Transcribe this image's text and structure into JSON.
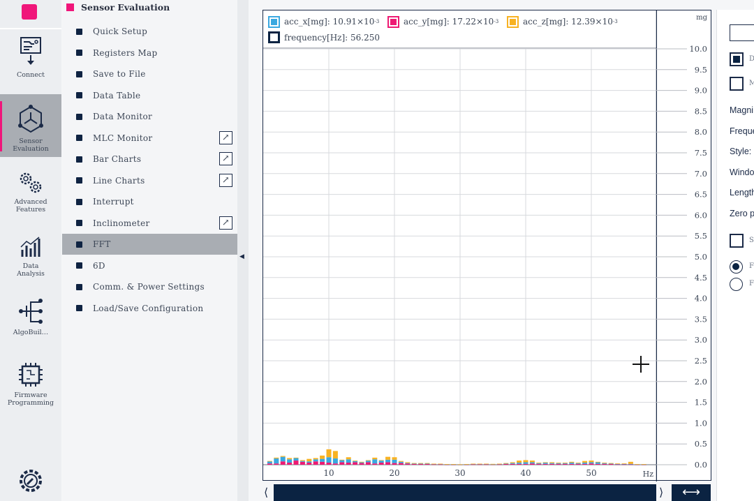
{
  "rail": {
    "items": [
      {
        "label": "Connect",
        "icon": "connect-board-icon"
      },
      {
        "label": "Sensor Evaluation",
        "icon": "sensor-hexagon-icon",
        "selected": true
      },
      {
        "label": "Advanced Features",
        "icon": "gears-icon"
      },
      {
        "label": "Data Analysis",
        "icon": "analysis-chart-icon"
      },
      {
        "label": "AlgoBuil…",
        "icon": "algo-tree-icon"
      },
      {
        "label": "Firmware Programming",
        "icon": "chip-icon"
      }
    ],
    "settings_icon": "settings-gear-icon"
  },
  "menu": {
    "title": "Sensor Evaluation",
    "items": [
      {
        "label": "Quick Setup",
        "external": false
      },
      {
        "label": "Registers Map",
        "external": false
      },
      {
        "label": "Save to File",
        "external": false
      },
      {
        "label": "Data Table",
        "external": false
      },
      {
        "label": "Data Monitor",
        "external": false
      },
      {
        "label": "MLC Monitor",
        "external": true
      },
      {
        "label": "Bar Charts",
        "external": true
      },
      {
        "label": "Line Charts",
        "external": true
      },
      {
        "label": "Interrupt",
        "external": false
      },
      {
        "label": "Inclinometer",
        "external": true
      },
      {
        "label": "FFT",
        "external": false,
        "selected": true
      },
      {
        "label": "6D",
        "external": false
      },
      {
        "label": "Comm. & Power Settings",
        "external": false
      },
      {
        "label": "Load/Save Configuration",
        "external": false
      }
    ]
  },
  "legend": {
    "acc_x": {
      "label": "acc_x[mg]: 10.91×10",
      "exp": "-3",
      "color": "#3aa8e0"
    },
    "acc_y": {
      "label": "acc_y[mg]: 17.22×10",
      "exp": "-3",
      "color": "#ee1a73"
    },
    "acc_z": {
      "label": "acc_z[mg]: 12.39×10",
      "exp": "-3",
      "color": "#f8b222"
    },
    "frequency": {
      "label": "frequency[Hz]: 56.250",
      "color": "#0b2342"
    }
  },
  "chart_data": {
    "type": "bar",
    "stacked": true,
    "xlabel": "Hz",
    "ylabel": "mg",
    "xlim": [
      0,
      60
    ],
    "ylim": [
      0,
      10
    ],
    "xticks": [
      10,
      20,
      30,
      40,
      50
    ],
    "yticks": [
      "0.0",
      "0.5",
      "1.0",
      "1.5",
      "2.0",
      "2.5",
      "3.0",
      "3.5",
      "4.0",
      "4.5",
      "5.0",
      "5.5",
      "6.0",
      "6.5",
      "7.0",
      "7.5",
      "8.0",
      "8.5",
      "9.0",
      "9.5",
      "10.0"
    ],
    "grid": true,
    "x": [
      1,
      2,
      3,
      4,
      5,
      6,
      7,
      8,
      9,
      10,
      11,
      12,
      13,
      14,
      15,
      16,
      17,
      18,
      19,
      20,
      21,
      22,
      23,
      24,
      25,
      26,
      27,
      28,
      29,
      30,
      31,
      32,
      33,
      34,
      35,
      36,
      37,
      38,
      39,
      40,
      41,
      42,
      43,
      44,
      45,
      46,
      47,
      48,
      49,
      50,
      51,
      52,
      53,
      54,
      55,
      56,
      57,
      58
    ],
    "series": [
      {
        "name": "acc_x",
        "color": "#3aa8e0",
        "values": [
          0.05,
          0.12,
          0.11,
          0.08,
          0.06,
          0.02,
          0.03,
          0.05,
          0.07,
          0.13,
          0.12,
          0.05,
          0.08,
          0.03,
          0.02,
          0.04,
          0.1,
          0.05,
          0.06,
          0.08,
          0.03,
          0.01,
          0.01,
          0.01,
          0.01,
          0.01,
          0.01,
          0.005,
          0.005,
          0.003,
          0.005,
          0.01,
          0.01,
          0.01,
          0.005,
          0.01,
          0.01,
          0.02,
          0.03,
          0.04,
          0.03,
          0.02,
          0.03,
          0.02,
          0.02,
          0.02,
          0.03,
          0.02,
          0.03,
          0.03,
          0.04,
          0.02,
          0.01,
          0.01,
          0.01,
          0.01,
          0.005,
          0.005
        ]
      },
      {
        "name": "acc_y",
        "color": "#ee1a73",
        "values": [
          0.03,
          0.03,
          0.08,
          0.05,
          0.1,
          0.07,
          0.05,
          0.08,
          0.07,
          0.05,
          0.03,
          0.06,
          0.05,
          0.06,
          0.04,
          0.06,
          0.03,
          0.05,
          0.06,
          0.04,
          0.04,
          0.03,
          0.02,
          0.02,
          0.02,
          0.01,
          0.01,
          0.005,
          0.005,
          0.003,
          0.005,
          0.01,
          0.01,
          0.01,
          0.01,
          0.01,
          0.02,
          0.02,
          0.02,
          0.02,
          0.03,
          0.02,
          0.02,
          0.02,
          0.02,
          0.02,
          0.02,
          0.02,
          0.02,
          0.03,
          0.02,
          0.02,
          0.02,
          0.01,
          0.01,
          0.01,
          0.005,
          0.005
        ]
      },
      {
        "name": "acc_z",
        "color": "#f8b222",
        "values": [
          0.01,
          0.02,
          0.02,
          0.03,
          0.01,
          0.02,
          0.06,
          0.03,
          0.08,
          0.19,
          0.18,
          0.01,
          0.05,
          0.01,
          0.01,
          0.01,
          0.04,
          0.01,
          0.07,
          0.06,
          0.02,
          0.02,
          0.01,
          0.01,
          0.01,
          0.005,
          0.005,
          0.005,
          0.005,
          0.003,
          0.005,
          0.005,
          0.005,
          0.005,
          0.005,
          0.005,
          0.01,
          0.02,
          0.05,
          0.05,
          0.04,
          0.01,
          0.01,
          0.02,
          0.01,
          0.01,
          0.02,
          0.01,
          0.04,
          0.04,
          0.01,
          0.01,
          0.01,
          0.01,
          0.01,
          0.05,
          0.005,
          0.005
        ]
      }
    ]
  },
  "right_panel": {
    "checkboxes": [
      {
        "label": "D",
        "checked": true
      },
      {
        "label": "M",
        "checked": false
      }
    ],
    "fields": [
      "Magni",
      "Freque",
      "Style:",
      "Windo",
      "Length",
      "Zero p"
    ],
    "checkbox2": {
      "label": "S",
      "checked": false
    },
    "radios": [
      {
        "label": "F",
        "checked": true
      },
      {
        "label": "F",
        "checked": false
      }
    ]
  },
  "scroll": {
    "left": "⟨",
    "right": "⟩",
    "fit": "⟷"
  }
}
